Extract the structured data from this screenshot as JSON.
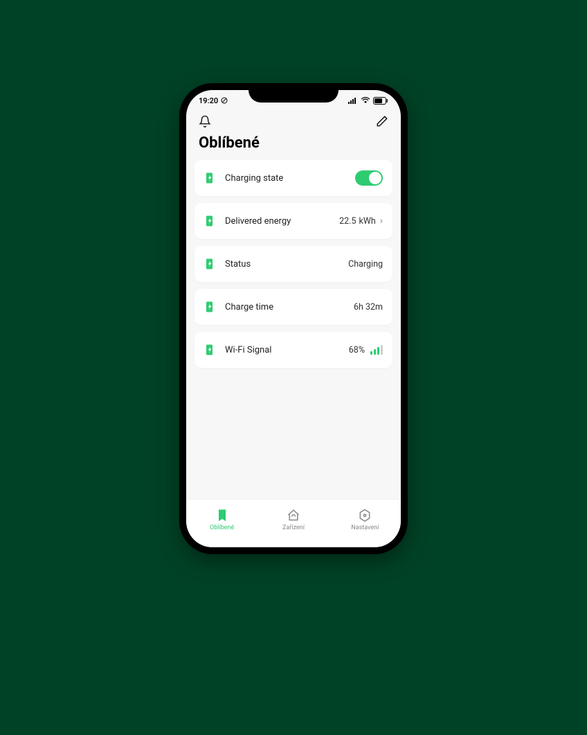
{
  "statusBar": {
    "time": "19:20"
  },
  "page": {
    "title": "Oblíbené"
  },
  "cards": {
    "chargingState": {
      "label": "Charging state",
      "on": true
    },
    "deliveredEnergy": {
      "label": "Delivered energy",
      "value": "22.5",
      "unit": "kWh"
    },
    "status": {
      "label": "Status",
      "value": "Charging"
    },
    "chargeTime": {
      "label": "Charge time",
      "value": "6h 32m"
    },
    "wifi": {
      "label": "Wi-Fi Signal",
      "value": "68%"
    }
  },
  "nav": {
    "favorites": "Oblíbené",
    "devices": "Zařízení",
    "settings": "Nastavení"
  }
}
